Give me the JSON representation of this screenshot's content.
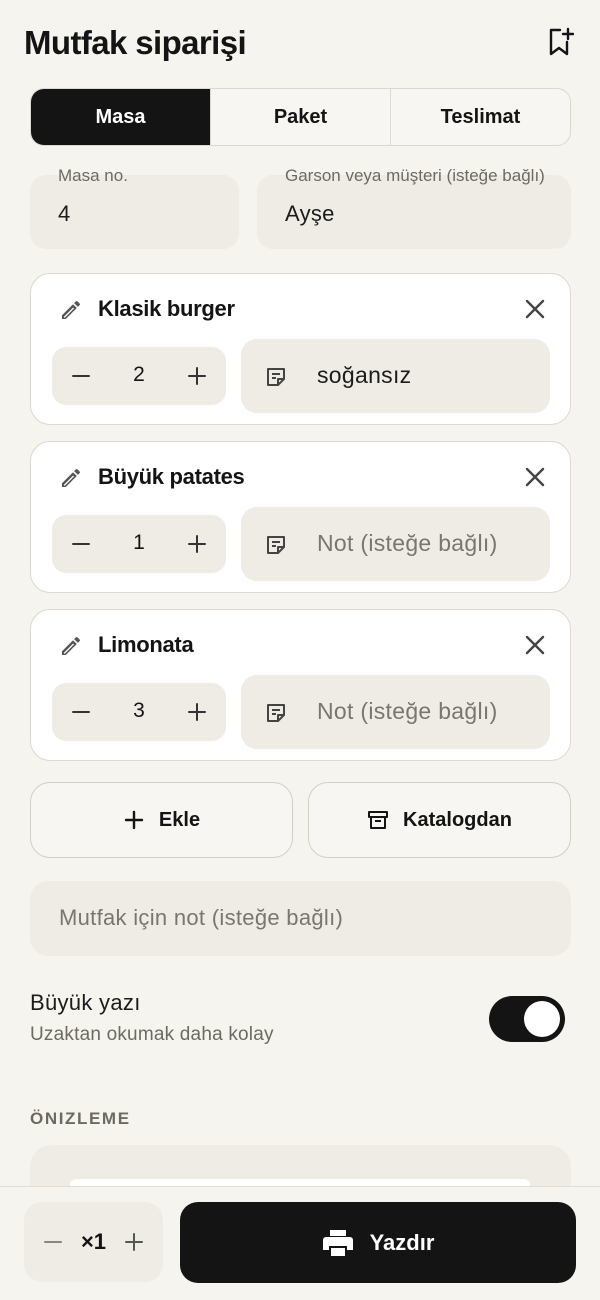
{
  "header": {
    "title": "Mutfak siparişi",
    "bookmark_icon": "bookmark-add-icon"
  },
  "order_types": [
    {
      "label": "Masa",
      "active": true
    },
    {
      "label": "Paket",
      "active": false
    },
    {
      "label": "Teslimat",
      "active": false
    }
  ],
  "fields": {
    "table": {
      "label": "Masa no.",
      "value": "4"
    },
    "customer": {
      "label": "Garson veya müşteri (isteğe bağlı)",
      "value": "Ayşe"
    }
  },
  "items": [
    {
      "name": "Klasik burger",
      "quantity": "2",
      "note": "soğansız",
      "note_placeholder": ""
    },
    {
      "name": "Büyük patates",
      "quantity": "1",
      "note": "",
      "note_placeholder": "Not (isteğe bağlı)"
    },
    {
      "name": "Limonata",
      "quantity": "3",
      "note": "",
      "note_placeholder": "Not (isteğe bağlı)"
    }
  ],
  "actions": {
    "add_label": "Ekle",
    "catalog_label": "Katalogdan"
  },
  "kitchen_note": {
    "placeholder": "Mutfak için not (isteğe bağlı)"
  },
  "large_text": {
    "title": "Büyük yazı",
    "subtitle": "Uzaktan okumak daha kolay",
    "enabled": true
  },
  "preview": {
    "section_label": "ÖNIZLEME"
  },
  "bottom": {
    "copies": "×1",
    "print_label": "Yazdır"
  },
  "colors": {
    "primary": "#141414",
    "background": "#f6f4ef",
    "field": "#efece5",
    "border": "#dcd8cf"
  }
}
